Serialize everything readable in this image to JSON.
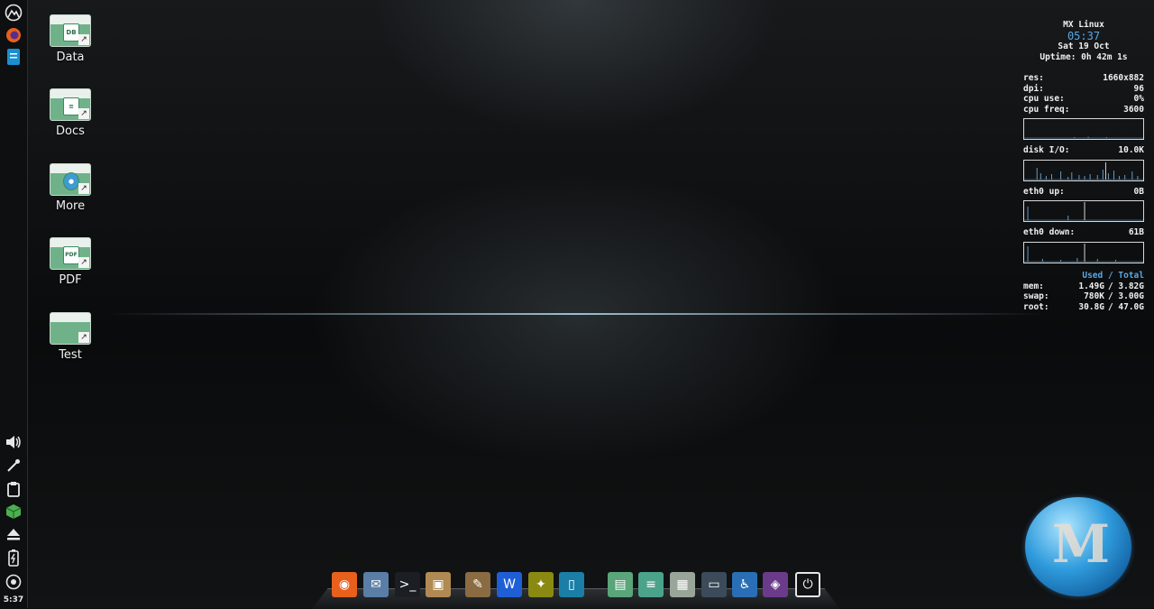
{
  "desktop_icons": [
    {
      "label": "Data",
      "emblem": "DB"
    },
    {
      "label": "Docs",
      "emblem": "≡"
    },
    {
      "label": "More",
      "emblem": "●"
    },
    {
      "label": "PDF",
      "emblem": "PDF"
    },
    {
      "label": "Test",
      "emblem": ""
    }
  ],
  "panel": {
    "clock": "5:37",
    "top_icons": [
      "mx-logo-icon",
      "firefox-icon",
      "file-manager-icon"
    ],
    "tray_icons": [
      "volume-icon",
      "color-picker-icon",
      "clipboard-icon",
      "package-updater-icon",
      "eject-icon",
      "battery-icon",
      "logout-icon"
    ]
  },
  "conky": {
    "title": "MX Linux",
    "time": "05:37",
    "date": "Sat 19 Oct",
    "uptime": "Uptime: 0h 42m 1s",
    "stats": [
      {
        "label": "res:",
        "value": "1660x882"
      },
      {
        "label": "dpi:",
        "value": "96"
      },
      {
        "label": "cpu use:",
        "value": "0%"
      },
      {
        "label": "cpu freq:",
        "value": "3600"
      }
    ],
    "disk": {
      "label": "disk I/O:",
      "value": "10.0K"
    },
    "eth_up": {
      "label": "eth0 up:",
      "value": "0B"
    },
    "eth_down": {
      "label": "eth0 down:",
      "value": "61B"
    },
    "usage_header": "Used / Total",
    "usage": [
      {
        "label": "mem:",
        "used": "1.49G",
        "total": "/ 3.82G"
      },
      {
        "label": "swap:",
        "used": "780K",
        "total": "/ 3.00G"
      },
      {
        "label": "root:",
        "used": "30.8G",
        "total": "/ 47.0G"
      }
    ]
  },
  "logo": {
    "text": "M"
  },
  "dock": [
    {
      "name": "firefox-icon",
      "glyph": "◉",
      "color": "#e8601c"
    },
    {
      "name": "mail-icon",
      "glyph": "✉",
      "color": "#5b7ea6"
    },
    {
      "name": "terminal-icon",
      "glyph": ">_",
      "color": "#1b1f24"
    },
    {
      "name": "package-installer-icon",
      "glyph": "▣",
      "color": "#b08a52"
    },
    {
      "name": "gimp-icon",
      "glyph": "✎",
      "color": "#8a6b42"
    },
    {
      "name": "wps-writer-icon",
      "glyph": "W",
      "color": "#1f5fd6"
    },
    {
      "name": "image-viewer-icon",
      "glyph": "✦",
      "color": "#8a8a12"
    },
    {
      "name": "file-manager-icon",
      "glyph": "▯",
      "color": "#1a7ea6"
    },
    {
      "name": "data-folder-icon",
      "glyph": "▤",
      "color": "#5aa57a"
    },
    {
      "name": "docs-folder-icon",
      "glyph": "≡",
      "color": "#4aa38a"
    },
    {
      "name": "pdf-folder-icon",
      "glyph": "▦",
      "color": "#9aa59a"
    },
    {
      "name": "window-icon",
      "glyph": "▭",
      "color": "#3b4b5a"
    },
    {
      "name": "accessibility-icon",
      "glyph": "♿",
      "color": "#2a6fb5"
    },
    {
      "name": "wallpaper-icon",
      "glyph": "◈",
      "color": "#6a3b8a"
    },
    {
      "name": "logout-icon",
      "glyph": "⏻",
      "color": "#111315"
    }
  ]
}
